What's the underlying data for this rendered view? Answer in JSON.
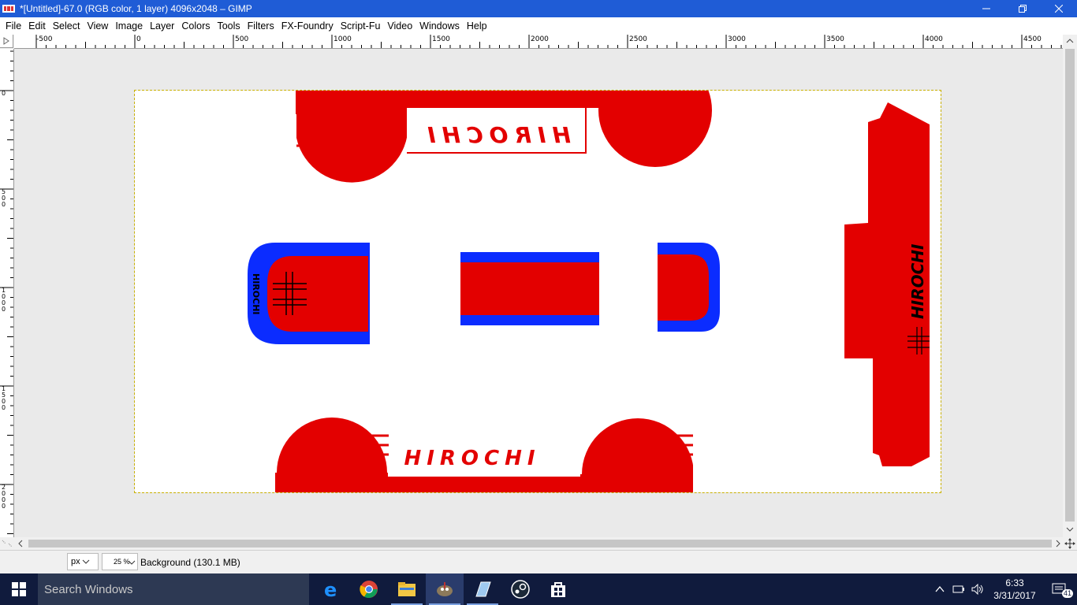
{
  "window": {
    "title": "*[Untitled]-67.0 (RGB color, 1 layer) 4096x2048 – GIMP"
  },
  "menu": [
    "File",
    "Edit",
    "Select",
    "View",
    "Image",
    "Layer",
    "Colors",
    "Tools",
    "Filters",
    "FX-Foundry",
    "Script-Fu",
    "Video",
    "Windows",
    "Help"
  ],
  "rulers": {
    "horizontal_labels": [
      "-500",
      "0",
      "500",
      "1000",
      "1500",
      "2000",
      "2500",
      "3000",
      "3500",
      "4000",
      "4500"
    ],
    "vertical_labels": [
      "0",
      "500",
      "1000",
      "1500",
      "2000"
    ]
  },
  "canvas": {
    "image_size": "4096x2048",
    "texts": {
      "top_brand": "HIROCHI",
      "bottom_brand": "HIROCHI",
      "side_brand": "HIROCHI",
      "small_brand": "HIROCHI"
    },
    "colors": {
      "red": "#e30000",
      "blue": "#0b2cff",
      "selection": "#c8b000"
    }
  },
  "statusbar": {
    "unit": "px",
    "zoom": "25 %",
    "layer_info": "Background (130.1 MB)"
  },
  "taskbar": {
    "search_placeholder": "Search Windows",
    "pinned": [
      "edge-icon",
      "chrome-icon",
      "file-explorer-icon",
      "gimp-icon",
      "notepad-icon",
      "steam-icon",
      "store-icon"
    ],
    "clock_time": "6:33",
    "clock_date": "3/31/2017",
    "notification_count": "41"
  }
}
